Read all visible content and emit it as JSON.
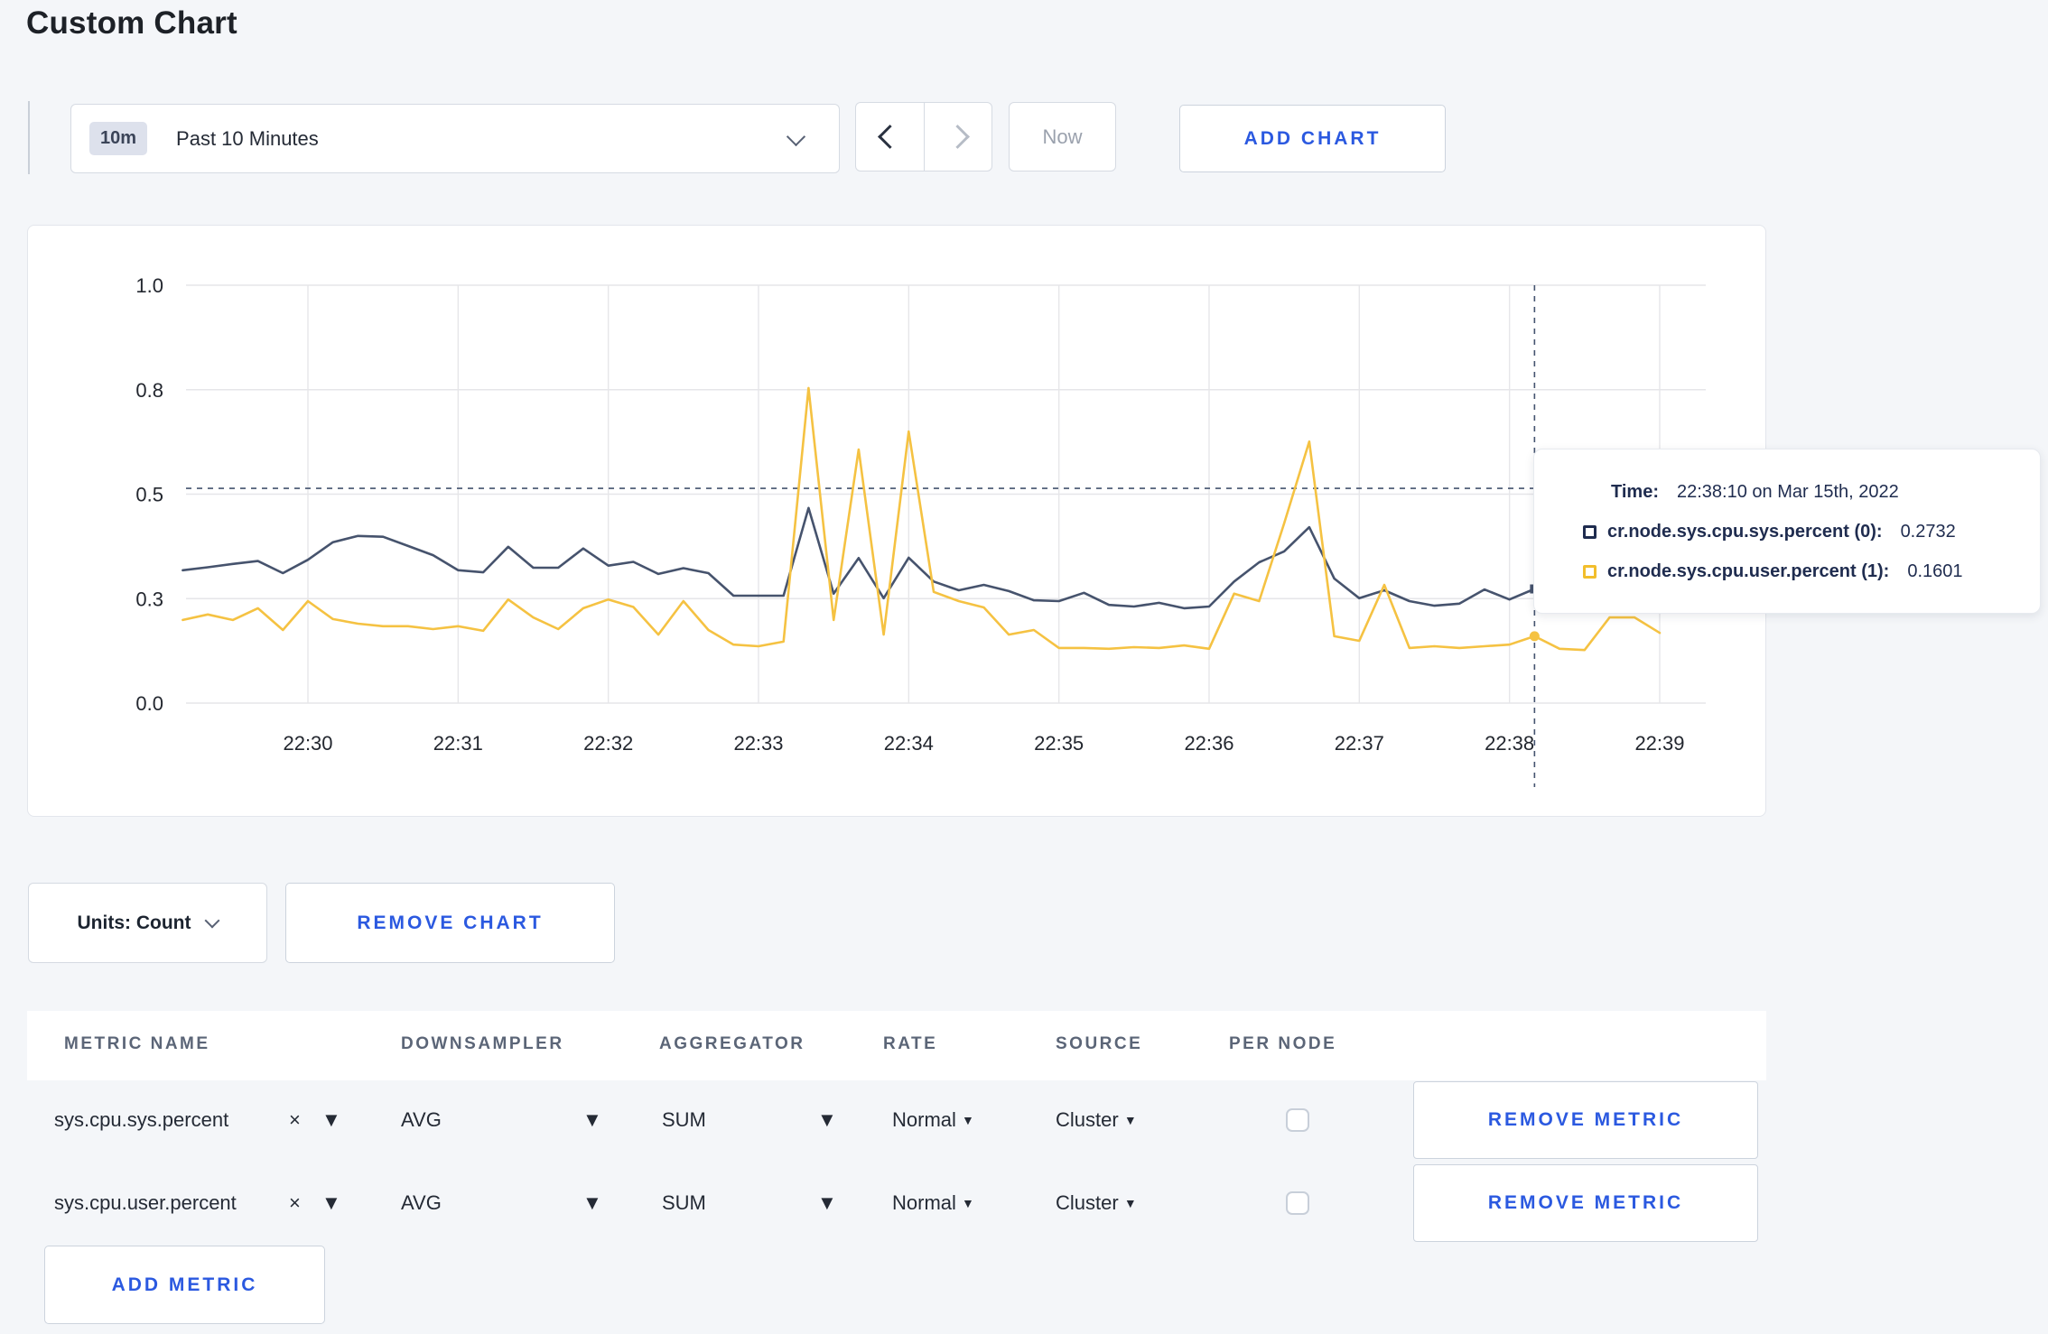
{
  "page": {
    "title": "Custom Chart"
  },
  "toolbar": {
    "time_scale": {
      "badge": "10m",
      "label": "Past 10 Minutes"
    },
    "now_label": "Now",
    "add_chart_label": "ADD CHART"
  },
  "chart_data": {
    "type": "line",
    "title": "",
    "xlabel": "",
    "ylabel": "",
    "x_start": "22:29:10",
    "x_interval_seconds": 10,
    "x_tick_labels": [
      "22:30",
      "22:31",
      "22:32",
      "22:33",
      "22:34",
      "22:35",
      "22:36",
      "22:37",
      "22:38",
      "22:39"
    ],
    "ylim": [
      0,
      1.0
    ],
    "y_tick_values": [
      1.0,
      0.75,
      0.5,
      0.25,
      0.0
    ],
    "y_tick_labels": [
      "1.0",
      "0.8",
      "0.5",
      "0.3",
      "0.0"
    ],
    "grid": true,
    "legend_position": "none",
    "series": [
      {
        "name": "cr.node.sys.cpu.sys.percent (0)",
        "color": "#46536d",
        "values": [
          0.318,
          0.325,
          0.333,
          0.34,
          0.311,
          0.343,
          0.385,
          0.4,
          0.398,
          0.376,
          0.354,
          0.318,
          0.313,
          0.374,
          0.324,
          0.324,
          0.37,
          0.329,
          0.338,
          0.309,
          0.323,
          0.311,
          0.257,
          0.257,
          0.257,
          0.467,
          0.262,
          0.347,
          0.251,
          0.348,
          0.291,
          0.27,
          0.283,
          0.268,
          0.246,
          0.244,
          0.264,
          0.235,
          0.231,
          0.24,
          0.227,
          0.231,
          0.291,
          0.337,
          0.363,
          0.421,
          0.298,
          0.251,
          0.27,
          0.244,
          0.233,
          0.238,
          0.272,
          0.248,
          0.2732,
          0.251,
          0.262,
          0.27,
          0.276,
          0.268
        ]
      },
      {
        "name": "cr.node.sys.cpu.user.percent (1)",
        "color": "#f5c242",
        "values": [
          0.199,
          0.212,
          0.199,
          0.227,
          0.175,
          0.244,
          0.201,
          0.19,
          0.184,
          0.184,
          0.177,
          0.184,
          0.173,
          0.248,
          0.205,
          0.177,
          0.227,
          0.248,
          0.23,
          0.164,
          0.244,
          0.175,
          0.14,
          0.136,
          0.147,
          0.754,
          0.199,
          0.607,
          0.164,
          0.65,
          0.266,
          0.244,
          0.229,
          0.164,
          0.175,
          0.132,
          0.132,
          0.13,
          0.134,
          0.132,
          0.138,
          0.13,
          0.262,
          0.244,
          0.43,
          0.626,
          0.16,
          0.149,
          0.283,
          0.132,
          0.136,
          0.132,
          0.136,
          0.14,
          0.1601,
          0.13,
          0.127,
          0.205,
          0.205,
          0.168
        ]
      }
    ],
    "hover": {
      "index": 54,
      "guideline_value": 0.514
    }
  },
  "tooltip": {
    "time_label": "Time:",
    "time_value": "22:38:10 on Mar 15th, 2022",
    "rows": [
      {
        "label": "cr.node.sys.cpu.sys.percent (0):",
        "value": "0.2732",
        "color": "#1f2c4f"
      },
      {
        "label": "cr.node.sys.cpu.user.percent (1):",
        "value": "0.1601",
        "color": "#f2be2c"
      }
    ]
  },
  "units": {
    "label": "Units: Count"
  },
  "remove_chart_label": "REMOVE CHART",
  "icons": {
    "caret": "▼",
    "clear": "×"
  },
  "metrics_table": {
    "headers": [
      "METRIC NAME",
      "DOWNSAMPLER",
      "AGGREGATOR",
      "RATE",
      "SOURCE",
      "PER NODE"
    ],
    "rows": [
      {
        "metric": "sys.cpu.sys.percent",
        "downsampler": "AVG",
        "aggregator": "SUM",
        "rate": "Normal",
        "source": "Cluster",
        "per_node_checked": false,
        "remove_label": "REMOVE METRIC"
      },
      {
        "metric": "sys.cpu.user.percent",
        "downsampler": "AVG",
        "aggregator": "SUM",
        "rate": "Normal",
        "source": "Cluster",
        "per_node_checked": false,
        "remove_label": "REMOVE METRIC"
      }
    ],
    "add_metric_label": "ADD METRIC"
  }
}
